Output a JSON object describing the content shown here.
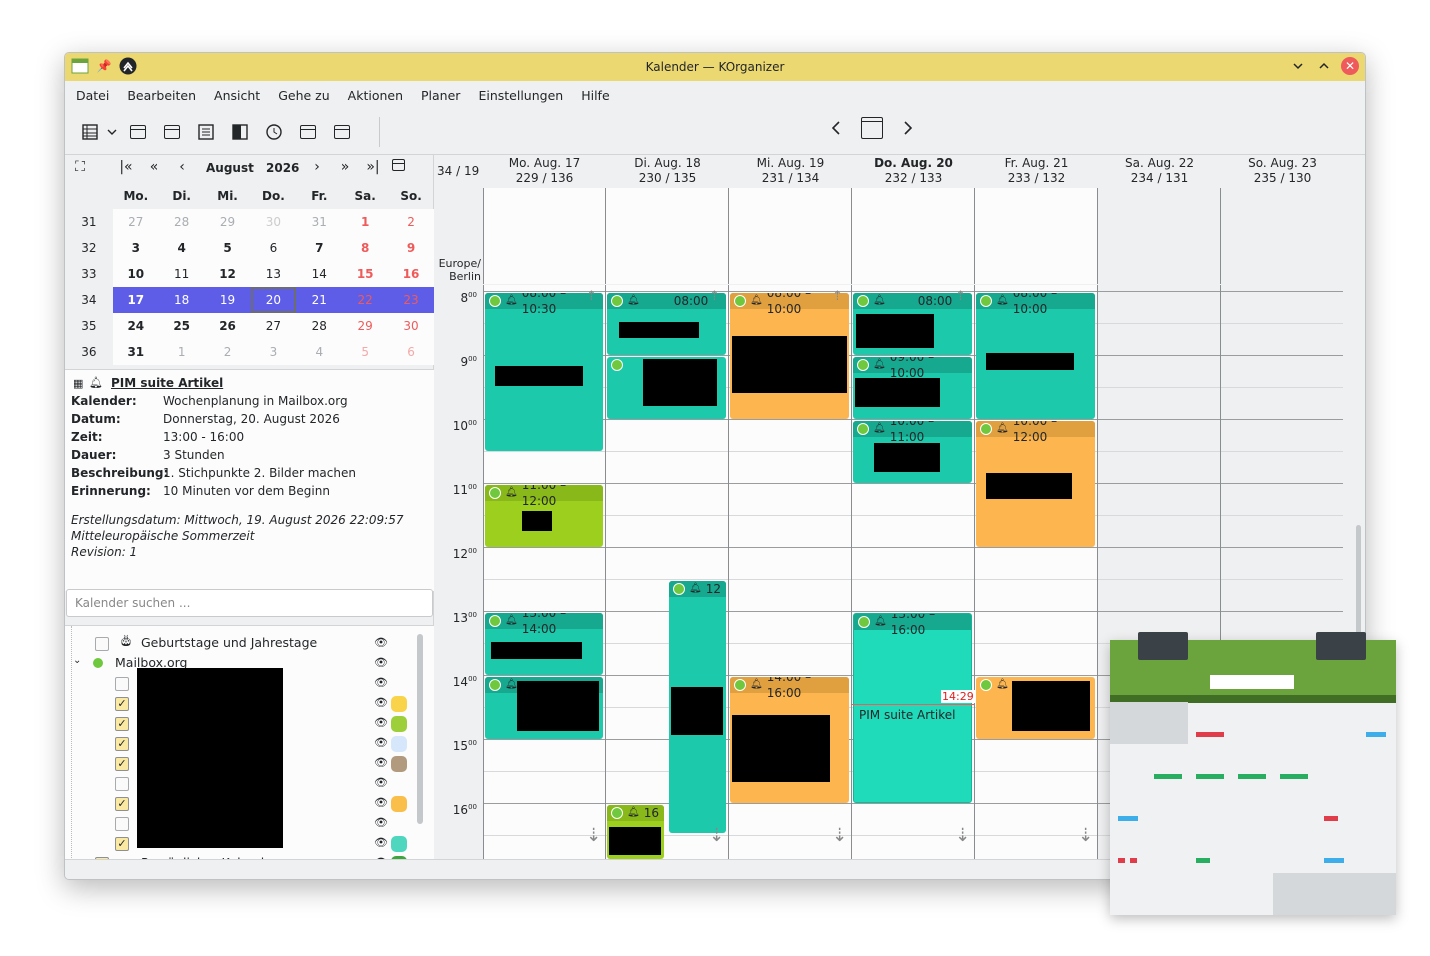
{
  "window": {
    "title": "Kalender — KOrganizer"
  },
  "menu": [
    "Datei",
    "Bearbeiten",
    "Ansicht",
    "Gehe zu",
    "Aktionen",
    "Planer",
    "Einstellungen",
    "Hilfe"
  ],
  "datenavigator": {
    "month": "August",
    "year": "2026",
    "weekdays": [
      "Mo.",
      "Di.",
      "Mi.",
      "Do.",
      "Fr.",
      "Sa.",
      "So."
    ],
    "weeks": [
      {
        "wk": "31",
        "days": [
          "27",
          "28",
          "29",
          "30",
          "31",
          "1",
          "2"
        ]
      },
      {
        "wk": "32",
        "days": [
          "3",
          "4",
          "5",
          "6",
          "7",
          "8",
          "9"
        ]
      },
      {
        "wk": "33",
        "days": [
          "10",
          "11",
          "12",
          "13",
          "14",
          "15",
          "16"
        ]
      },
      {
        "wk": "34",
        "days": [
          "17",
          "18",
          "19",
          "20",
          "21",
          "22",
          "23"
        ]
      },
      {
        "wk": "35",
        "days": [
          "24",
          "25",
          "26",
          "27",
          "28",
          "29",
          "30"
        ]
      },
      {
        "wk": "36",
        "days": [
          "31",
          "1",
          "2",
          "3",
          "4",
          "5",
          "6"
        ]
      }
    ]
  },
  "event_info": {
    "title": "PIM suite Artikel",
    "rows": [
      {
        "k": "Kalender:",
        "v": "Wochenplanung in Mailbox.org"
      },
      {
        "k": "Datum:",
        "v": "Donnerstag, 20. August 2026"
      },
      {
        "k": "Zeit:",
        "v": "13:00 - 16:00"
      },
      {
        "k": "Dauer:",
        "v": "3 Stunden"
      },
      {
        "k": "Beschreibung:",
        "v": "1. Stichpunkte 2. Bilder machen"
      },
      {
        "k": "Erinnerung:",
        "v": "10 Minuten vor dem Beginn"
      }
    ],
    "created": "Erstellungsdatum: Mittwoch, 19. August 2026 22:09:57",
    "tz": "Mitteleuropäische Sommerzeit",
    "revision": "Revision: 1"
  },
  "search": {
    "placeholder": "Kalender suchen ..."
  },
  "calendars": {
    "birthdays": "Geburtstage und Jahrestage",
    "mailbox": "Mailbox.org",
    "personal": "Persönlicher Kalender",
    "colors": [
      "#f9d34a",
      "#9dcf3a",
      "#d6e6fb",
      "#b29a7e",
      "#f9bf4a",
      "#4fd6be",
      "#3ca63c"
    ]
  },
  "agenda": {
    "week_label": "34 / 19",
    "timezone": "Europe/\nBerlin",
    "days": [
      {
        "name": "Mo. Aug. 17",
        "num": "229 / 136"
      },
      {
        "name": "Di. Aug. 18",
        "num": "230 / 135"
      },
      {
        "name": "Mi. Aug. 19",
        "num": "231 / 134"
      },
      {
        "name": "Do. Aug. 20",
        "num": "232 / 133"
      },
      {
        "name": "Fr. Aug. 21",
        "num": "233 / 132"
      },
      {
        "name": "Sa. Aug. 22",
        "num": "234 / 131"
      },
      {
        "name": "So. Aug. 23",
        "num": "235 / 130"
      }
    ],
    "hours": [
      "8",
      "9",
      "10",
      "11",
      "12",
      "13",
      "14",
      "15",
      "16"
    ],
    "events": {
      "mo1": "08:00 – 10:30",
      "mo2": "11:00 – 12:00",
      "mo3": "13:00 – 14:00",
      "di1": "08:00",
      "di3": "12",
      "di4": "16",
      "mi1": "08:00 – 10:00",
      "mi2": "14:00 – 16:00",
      "do1": "08:00",
      "do2": "09:00 – 10:00",
      "do3": "10:00 – 11:00",
      "do4": "13:00 – 16:00",
      "do4_title": "PIM suite Artikel",
      "fr1": "08:00 – 10:00",
      "fr2": "10:00 – 12:00"
    },
    "now": "14:29"
  }
}
